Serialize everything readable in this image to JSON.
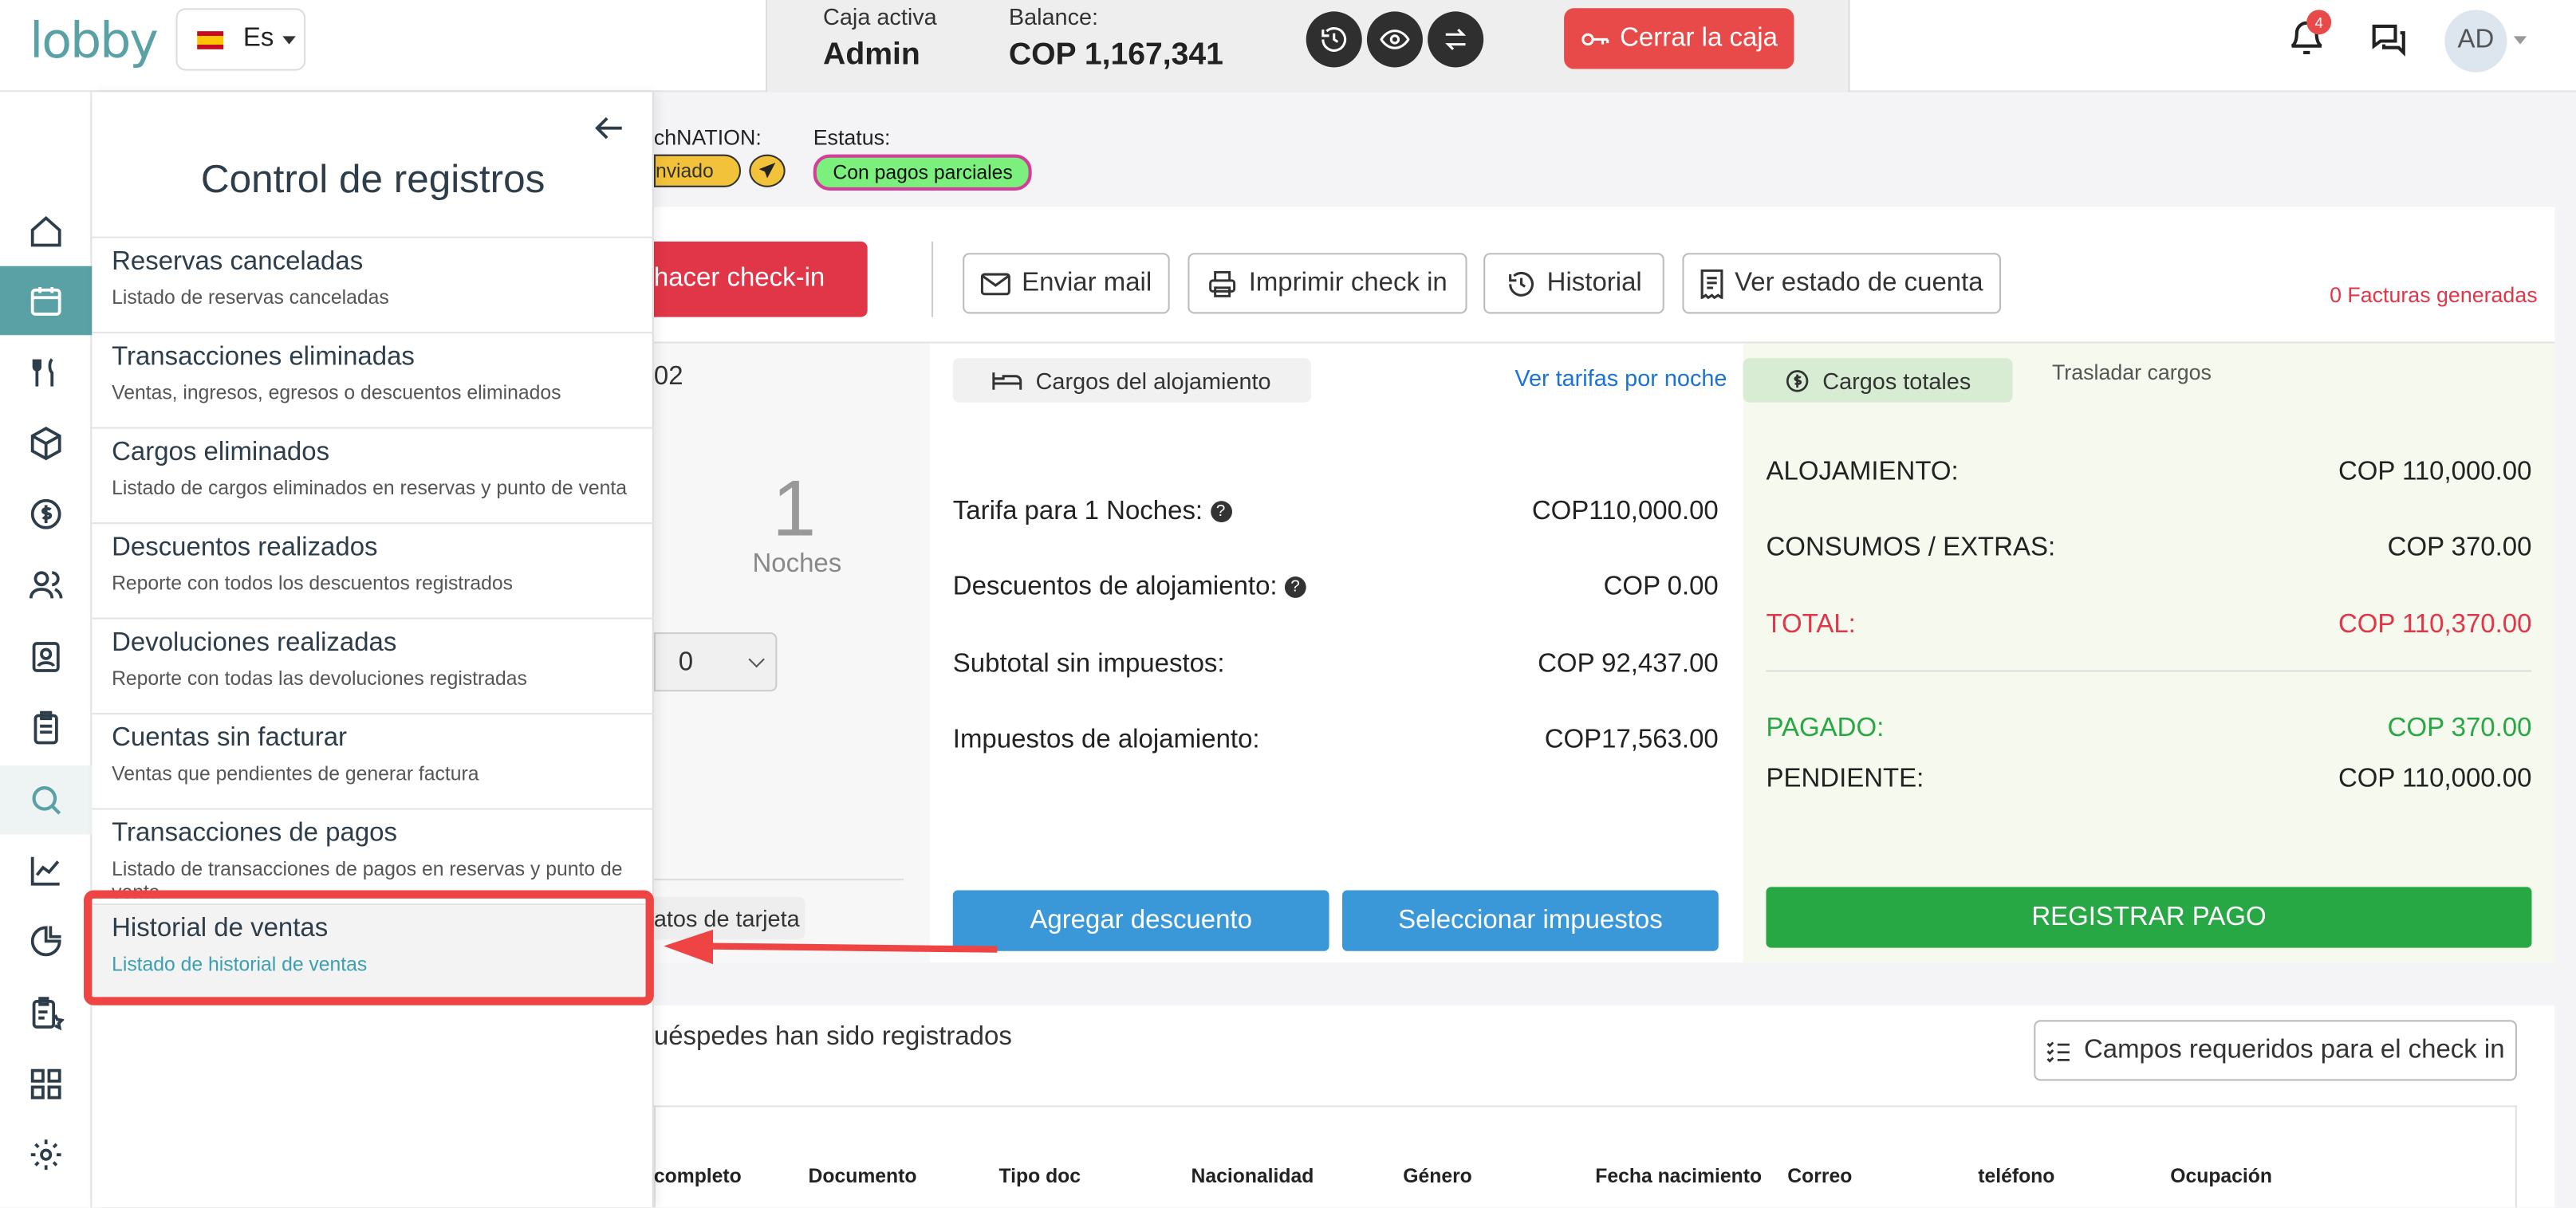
{
  "header": {
    "logo": "lobby",
    "lang_label": "Es",
    "caja_label": "Caja activa",
    "caja_value": "Admin",
    "balance_label": "Balance:",
    "balance_value": "COP 1,167,341",
    "close_label": "Cerrar la caja",
    "notif_count": "4",
    "avatar": "AD"
  },
  "booking": {
    "nation_label": "chNATION:",
    "nation_badge": "nviado",
    "status_label": "Estatus:",
    "status_badge": "Con pagos parciales",
    "checkin_label": "hacer check-in",
    "invoices": "0 Facturas generadas",
    "room_suffix": "02",
    "nights_num": "1",
    "nights_label": "Noches",
    "select_value": "0",
    "card_label": "atos de tarjeta"
  },
  "toolbar": {
    "mail": "Enviar mail",
    "print": "Imprimir check in",
    "history": "Historial",
    "account": "Ver estado de cuenta"
  },
  "charges": {
    "tab_lodging": "Cargos del alojamiento",
    "rates_link": "Ver tarifas por noche",
    "rows": [
      {
        "label": "Tarifa para 1 Noches:",
        "value": "COP110,000.00"
      },
      {
        "label": "Descuentos de alojamiento:",
        "value": "COP 0.00"
      },
      {
        "label": "Subtotal sin impuestos:",
        "value": "COP 92,437.00"
      },
      {
        "label": "Impuestos de alojamiento:",
        "value": "COP17,563.00"
      }
    ],
    "discount_btn": "Agregar descuento",
    "taxes_btn": "Seleccionar impuestos"
  },
  "totals": {
    "tab_total": "Cargos totales",
    "tab_move": "Trasladar cargos",
    "lodging_label": "ALOJAMIENTO:",
    "lodging_value": "COP 110,000.00",
    "extras_label": "CONSUMOS / EXTRAS:",
    "extras_value": "COP 370.00",
    "total_label": "TOTAL:",
    "total_value": "COP 110,370.00",
    "paid_label": "PAGADO:",
    "paid_value": "COP 370.00",
    "pending_label": "PENDIENTE:",
    "pending_value": "COP 110,000.00",
    "pay_btn": "REGISTRAR PAGO"
  },
  "guests": {
    "registered": "uéspedes han sido registrados",
    "required_btn": "Campos requeridos para el check in",
    "columns": [
      "completo",
      "Documento",
      "Tipo doc",
      "Nacionalidad",
      "Género",
      "Fecha nacimiento",
      "Correo",
      "teléfono",
      "Ocupación"
    ]
  },
  "drawer": {
    "title": "Control de registros",
    "items": [
      {
        "title": "Reservas canceladas",
        "sub": "Listado de reservas canceladas"
      },
      {
        "title": "Transacciones eliminadas",
        "sub": "Ventas, ingresos, egresos o descuentos eliminados"
      },
      {
        "title": "Cargos eliminados",
        "sub": "Listado de cargos eliminados en reservas y punto de venta"
      },
      {
        "title": "Descuentos realizados",
        "sub": "Reporte con todos los descuentos registrados"
      },
      {
        "title": "Devoluciones realizadas",
        "sub": "Reporte con todas las devoluciones registradas"
      },
      {
        "title": "Cuentas sin facturar",
        "sub": "Ventas que pendientes de generar factura"
      },
      {
        "title": "Transacciones de pagos",
        "sub": "Listado de transacciones de pagos en reservas y punto de venta"
      },
      {
        "title": "Historial de ventas",
        "sub": "Listado de historial de ventas"
      }
    ]
  },
  "colors": {
    "accent": "#5aa1a6",
    "red": "#e84a4a",
    "blue": "#3a98d9",
    "green": "#28a745",
    "highlight": "#ee4444"
  }
}
